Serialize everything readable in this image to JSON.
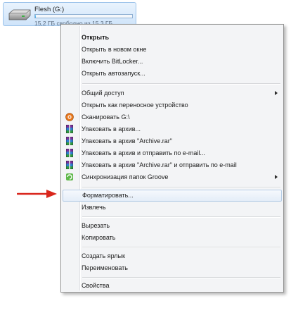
{
  "drive": {
    "name": "Flesh (G:)",
    "free_text": "15,2 ГБ свободно из 15,3 ГБ",
    "used_fraction": 0.01
  },
  "menu": {
    "items": [
      {
        "label": "Открыть",
        "bold": true
      },
      {
        "label": "Открыть в новом окне"
      },
      {
        "label": "Включить BitLocker..."
      },
      {
        "label": "Открыть автозапуск..."
      },
      {
        "label": "Общий доступ",
        "submenu": true
      },
      {
        "label": "Открыть как переносное устройство"
      },
      {
        "label": "Сканировать G:\\",
        "icon": "antivirus-icon"
      },
      {
        "label": "Упаковать в архив...",
        "icon": "winrar-icon"
      },
      {
        "label": "Упаковать в архив \"Archive.rar\"",
        "icon": "winrar-icon"
      },
      {
        "label": "Упаковать в архив и отправить по e-mail...",
        "icon": "winrar-icon"
      },
      {
        "label": "Упаковать в архив \"Archive.rar\" и отправить по e-mail",
        "icon": "winrar-icon"
      },
      {
        "label": "Синхронизация папок Groove",
        "icon": "groove-icon",
        "submenu": true
      },
      {
        "label": "Форматировать...",
        "highlighted": true
      },
      {
        "label": "Извлечь"
      },
      {
        "label": "Вырезать"
      },
      {
        "label": "Копировать"
      },
      {
        "label": "Создать ярлык"
      },
      {
        "label": "Переименовать"
      },
      {
        "label": "Свойства"
      }
    ]
  },
  "colors": {
    "highlight_border": "#b6cde6",
    "arrow": "#d9261c",
    "menu_bg": "#f3f4f6"
  }
}
